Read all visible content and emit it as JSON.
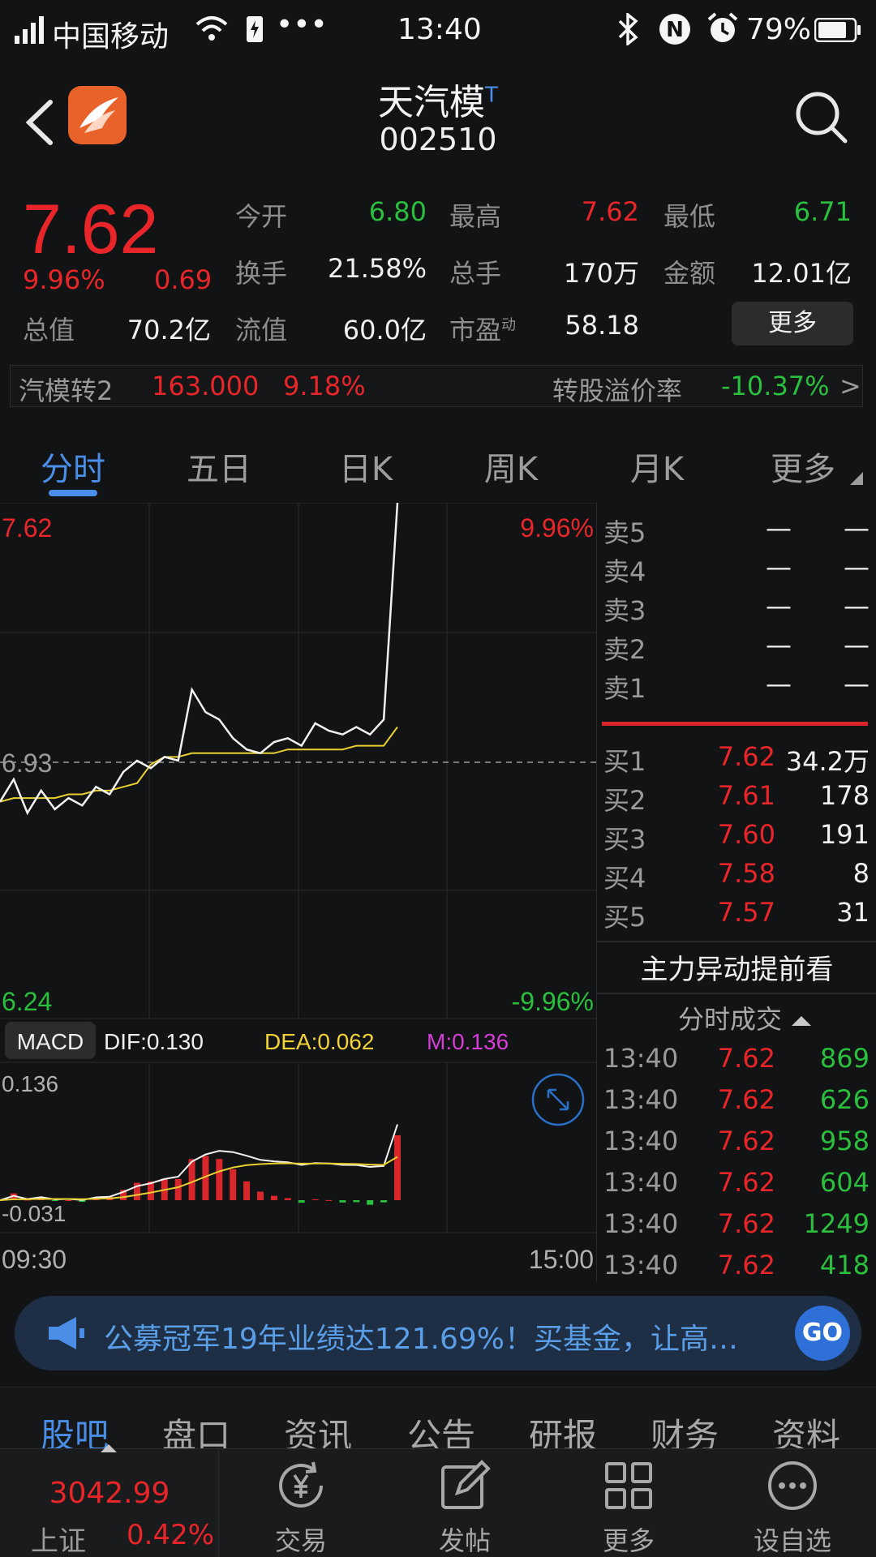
{
  "status_bar": {
    "carrier": "中国移动",
    "time": "13:40",
    "battery": "79%"
  },
  "header": {
    "name": "天汽模",
    "suffix": "T",
    "code": "002510"
  },
  "quote": {
    "price": "7.62",
    "change_pct": "9.96%",
    "change": "0.69",
    "open_label": "今开",
    "open": "6.80",
    "high_label": "最高",
    "high": "7.62",
    "low_label": "最低",
    "low": "6.71",
    "turnover_label": "换手",
    "turnover": "21.58%",
    "volume_label": "总手",
    "volume": "170万",
    "amount_label": "金额",
    "amount": "12.01亿",
    "mktcap_label": "总值",
    "mktcap": "70.2亿",
    "float_label": "流值",
    "float": "60.0亿",
    "pe_label": "市盈",
    "pe_sup": "动",
    "pe": "58.18",
    "more": "更多"
  },
  "convertible": {
    "name": "汽模转2",
    "price": "163.000",
    "pct": "9.18%",
    "premium_label": "转股溢价率",
    "premium": "-10.37%",
    "arrow": ">"
  },
  "tabs": [
    "分时",
    "五日",
    "日K",
    "周K",
    "月K",
    "更多"
  ],
  "chart": {
    "top_price": "7.62",
    "top_pct": "9.96%",
    "mid_price": "6.93",
    "bottom_price": "6.24",
    "bottom_pct": "-9.96%",
    "macd_label": "MACD",
    "dif": "DIF:0.130",
    "dea": "DEA:0.062",
    "m": "M:0.136",
    "macd_top": "0.136",
    "macd_bottom": "-0.031",
    "time_start": "09:30",
    "time_end": "15:00"
  },
  "chart_data": {
    "type": "line",
    "title": "",
    "xlabel": "",
    "ylabel": "",
    "ylim": [
      6.24,
      7.62
    ],
    "x_range": [
      "09:30",
      "15:00"
    ],
    "series": [
      {
        "values": [
          6.82,
          6.88,
          6.79,
          6.85,
          6.8,
          6.83,
          6.81,
          6.86,
          6.84,
          6.9,
          6.93,
          6.91,
          6.94,
          6.93,
          7.12,
          7.06,
          7.04,
          6.99,
          6.96,
          6.95,
          6.98,
          6.99,
          6.97,
          7.03,
          7.01,
          7.0,
          7.02,
          7.0,
          7.04,
          7.62
        ]
      },
      {
        "values": [
          6.82,
          6.83,
          6.83,
          6.83,
          6.83,
          6.84,
          6.84,
          6.85,
          6.85,
          6.86,
          6.87,
          6.92,
          6.94,
          6.94,
          6.95,
          6.95,
          6.95,
          6.95,
          6.95,
          6.95,
          6.95,
          6.96,
          6.96,
          6.96,
          6.96,
          6.96,
          6.97,
          6.97,
          6.97,
          7.02
        ]
      }
    ]
  },
  "orderbook": {
    "asks": [
      {
        "label": "卖5",
        "price": "—",
        "vol": "—"
      },
      {
        "label": "卖4",
        "price": "—",
        "vol": "—"
      },
      {
        "label": "卖3",
        "price": "—",
        "vol": "—"
      },
      {
        "label": "卖2",
        "price": "—",
        "vol": "—"
      },
      {
        "label": "卖1",
        "price": "—",
        "vol": "—"
      }
    ],
    "bids": [
      {
        "label": "买1",
        "price": "7.62",
        "vol": "34.2万"
      },
      {
        "label": "买2",
        "price": "7.61",
        "vol": "178"
      },
      {
        "label": "买3",
        "price": "7.60",
        "vol": "191"
      },
      {
        "label": "买4",
        "price": "7.58",
        "vol": "8"
      },
      {
        "label": "买5",
        "price": "7.57",
        "vol": "31"
      }
    ],
    "main_force": "主力异动提前看",
    "ticks_title": "分时成交",
    "ticks": [
      {
        "time": "13:40",
        "price": "7.62",
        "vol": "869"
      },
      {
        "time": "13:40",
        "price": "7.62",
        "vol": "626"
      },
      {
        "time": "13:40",
        "price": "7.62",
        "vol": "958"
      },
      {
        "time": "13:40",
        "price": "7.62",
        "vol": "604"
      },
      {
        "time": "13:40",
        "price": "7.62",
        "vol": "1249"
      },
      {
        "time": "13:40",
        "price": "7.62",
        "vol": "418"
      }
    ]
  },
  "promo": {
    "text": "公募冠军19年业绩达121.69%！买基金，让高…",
    "go": "GO"
  },
  "info_tabs": [
    "股吧",
    "盘口",
    "资讯",
    "公告",
    "研报",
    "财务",
    "资料"
  ],
  "bottom_nav": {
    "index_value": "3042.99",
    "index_name": "上证",
    "index_pct": "0.42%",
    "items": [
      "交易",
      "发帖",
      "更多",
      "设自选"
    ]
  }
}
